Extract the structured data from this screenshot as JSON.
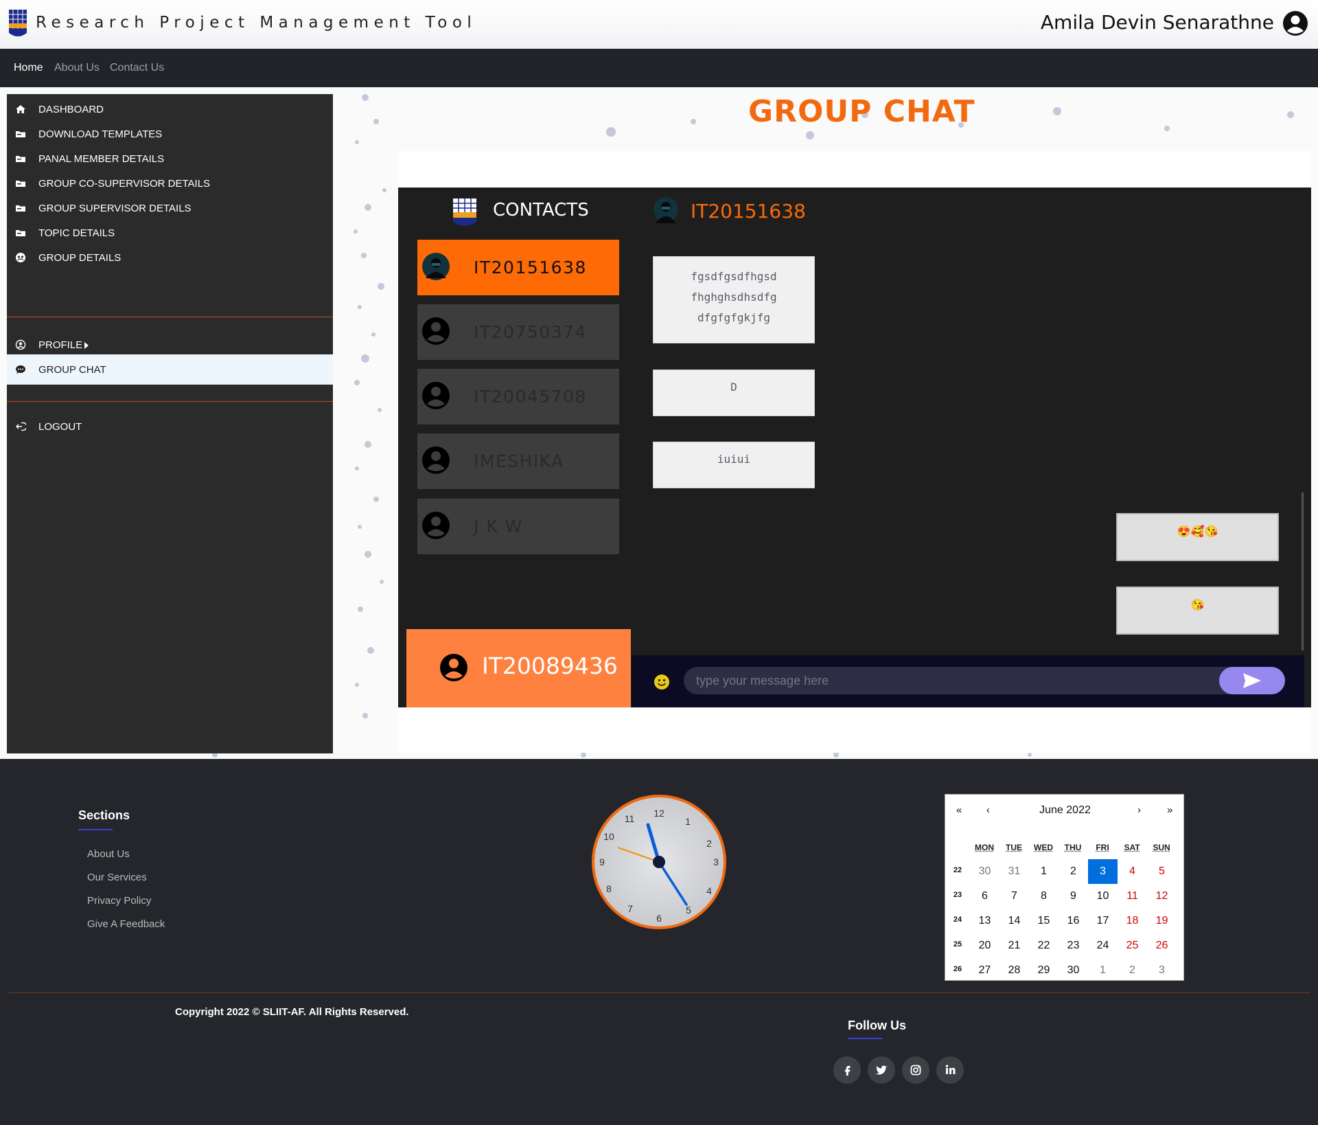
{
  "header": {
    "app_title": "Research Project Management Tool",
    "user_name": "Amila Devin Senarathne"
  },
  "navbar": {
    "links": [
      "Home",
      "About Us",
      "Contact Us"
    ]
  },
  "sidebar": {
    "items": [
      {
        "label": "DASHBOARD",
        "icon": "home-icon"
      },
      {
        "label": "DOWNLOAD TEMPLATES",
        "icon": "folder-icon"
      },
      {
        "label": "PANAL MEMBER DETAILS",
        "icon": "folder-icon"
      },
      {
        "label": "GROUP CO-SUPERVISOR DETAILS",
        "icon": "folder-icon"
      },
      {
        "label": "GROUP SUPERVISOR DETAILS",
        "icon": "folder-icon"
      },
      {
        "label": "TOPIC DETAILS",
        "icon": "folder-icon"
      },
      {
        "label": "GROUP DETAILS",
        "icon": "group-icon"
      }
    ],
    "profile_label": "PROFILE",
    "group_chat_label": "GROUP CHAT",
    "logout_label": "LOGOUT"
  },
  "page": {
    "heading": "GROUP CHAT"
  },
  "chat": {
    "contacts_title": "CONTACTS",
    "contacts": [
      "IT20151638",
      "IT20750374",
      "IT20045708",
      "IMESHIKA",
      "J K W"
    ],
    "active_contact": "IT20151638",
    "current_user": "IT20089436",
    "messages": [
      {
        "text": "fgsdfgsdfhgsd fhghghsdhsdfg dfgfgfgkjfg",
        "mine": false
      },
      {
        "text": "D",
        "mine": false
      },
      {
        "text": "iuiui",
        "mine": false
      },
      {
        "text": "😍🥰😘",
        "mine": true
      },
      {
        "text": "😘",
        "mine": true
      }
    ],
    "input_placeholder": "type your message here"
  },
  "footer": {
    "sections_title": "Sections",
    "links": [
      "About Us",
      "Our Services",
      "Privacy Policy",
      "Give A Feedback"
    ],
    "copyright": "Copyright 2022 © SLIIT-AF. All Rights Reserved.",
    "follow_title": "Follow Us",
    "social": [
      "f",
      "t",
      "ig",
      "in"
    ],
    "clock_numbers": [
      "12",
      "1",
      "2",
      "3",
      "4",
      "5",
      "6",
      "7",
      "8",
      "9",
      "10",
      "11"
    ],
    "calendar": {
      "nav": [
        "«",
        "‹",
        "›",
        "»"
      ],
      "title": "June 2022",
      "weekdays": [
        "MON",
        "TUE",
        "WED",
        "THU",
        "FRI",
        "SAT",
        "SUN"
      ],
      "weeks": [
        "22",
        "23",
        "24",
        "25",
        "26"
      ],
      "days": [
        [
          "30",
          "31",
          "1",
          "2",
          "3",
          "4",
          "5"
        ],
        [
          "6",
          "7",
          "8",
          "9",
          "10",
          "11",
          "12"
        ],
        [
          "13",
          "14",
          "15",
          "16",
          "17",
          "18",
          "19"
        ],
        [
          "20",
          "21",
          "22",
          "23",
          "24",
          "25",
          "26"
        ],
        [
          "27",
          "28",
          "29",
          "30",
          "1",
          "2",
          "3"
        ]
      ],
      "selected_day": "3"
    }
  },
  "colors": {
    "accent": "#fd6a06",
    "navbar": "#212529",
    "sidebar": "#2b2b2b",
    "footer": "#24262b"
  }
}
